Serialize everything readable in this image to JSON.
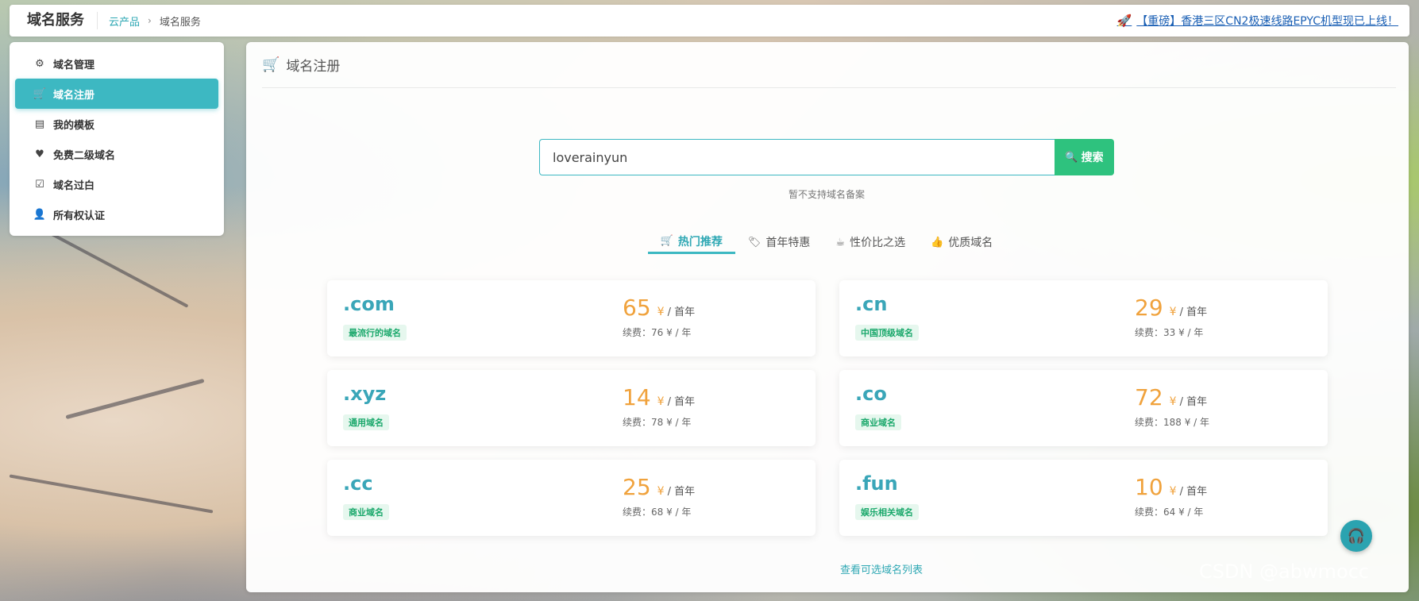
{
  "topbar": {
    "brand": "域名服务",
    "breadcrumb": [
      "云产品",
      "域名服务"
    ],
    "breadcrumb_sep": "›",
    "notice": "【重磅】香港三区CN2极速线路EPYC机型现已上线！",
    "notice_icon": "rocket-icon"
  },
  "sidebar": {
    "items": [
      {
        "label": "域名管理",
        "icon": "gears-icon",
        "active": false
      },
      {
        "label": "域名注册",
        "icon": "cart-icon",
        "active": true
      },
      {
        "label": "我的模板",
        "icon": "id-card-icon",
        "active": false
      },
      {
        "label": "免费二级域名",
        "icon": "heart-icon",
        "active": false
      },
      {
        "label": "域名过白",
        "icon": "inbox-check-icon",
        "active": false
      },
      {
        "label": "所有权认证",
        "icon": "user-check-icon",
        "active": false
      }
    ]
  },
  "main": {
    "title": "域名注册",
    "search": {
      "value": "loverainyun",
      "button": "搜索",
      "note": "暂不支持域名备案"
    },
    "tabs": [
      {
        "label": "热门推荐",
        "icon": "cart-icon",
        "active": true
      },
      {
        "label": "首年特惠",
        "icon": "tag-icon",
        "active": false
      },
      {
        "label": "性价比之选",
        "icon": "coffee-icon",
        "active": false
      },
      {
        "label": "优质域名",
        "icon": "thumbs-up-icon",
        "active": false
      }
    ],
    "cards": [
      {
        "tld": ".com",
        "tag": "最流行的域名",
        "price": "65",
        "currency": "¥",
        "per": "/ 首年",
        "renew": "续费：76 ¥ / 年"
      },
      {
        "tld": ".cn",
        "tag": "中国顶级域名",
        "price": "29",
        "currency": "¥",
        "per": "/ 首年",
        "renew": "续费：33 ¥ / 年"
      },
      {
        "tld": ".xyz",
        "tag": "通用域名",
        "price": "14",
        "currency": "¥",
        "per": "/ 首年",
        "renew": "续费：78 ¥ / 年"
      },
      {
        "tld": ".co",
        "tag": "商业域名",
        "price": "72",
        "currency": "¥",
        "per": "/ 首年",
        "renew": "续费：188 ¥ / 年"
      },
      {
        "tld": ".cc",
        "tag": "商业域名",
        "price": "25",
        "currency": "¥",
        "per": "/ 首年",
        "renew": "续费：68 ¥ / 年"
      },
      {
        "tld": ".fun",
        "tag": "娱乐相关域名",
        "price": "10",
        "currency": "¥",
        "per": "/ 首年",
        "renew": "续费：64 ¥ / 年"
      }
    ],
    "more_link": "查看可选域名列表"
  },
  "watermark": "CSDN @abwmocc",
  "colors": {
    "accent": "#3db8c2",
    "search_button": "#2ec27e",
    "price": "#f0a23c",
    "tag_text": "#1aa86b"
  }
}
